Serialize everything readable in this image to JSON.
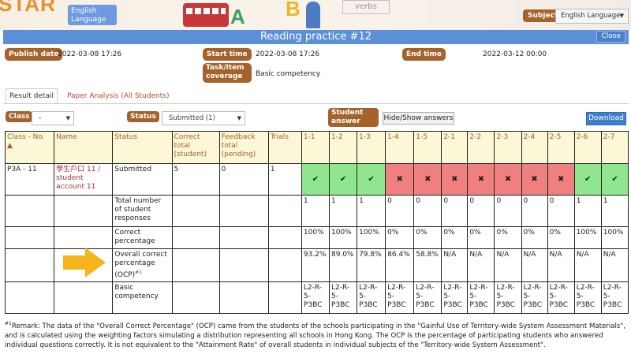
{
  "banner": {
    "logo": "STAR",
    "subject_badge": "English Language",
    "deco_a": "A",
    "deco_b": "B",
    "deco_verbs": "verbs",
    "subject_label": "Subject",
    "subject_value": "English Language"
  },
  "header": {
    "title": "Reading practice #12",
    "close_label": "Close"
  },
  "meta": {
    "publish_label": "Publish date",
    "publish_value": "2022-03-08 17:26",
    "start_label": "Start time",
    "start_value": "2022-03-08 17:26",
    "end_label": "End time",
    "end_value": "2022-03-12 00:00",
    "coverage_label": "Task/item coverage",
    "coverage_value": "Basic competency"
  },
  "tabs": {
    "result": "Result detail",
    "analysis": "Paper Analysis (All Students)"
  },
  "controls": {
    "class_label": "Class",
    "class_value": "-",
    "status_label": "Status",
    "status_value": "Submitted (1)",
    "answer_label": "Student answer",
    "hide_show": "Hide/Show answers",
    "download": "Download"
  },
  "table": {
    "headers": [
      "Class - No. ▲",
      "Name",
      "Status",
      "Correct total (student)",
      "Feedback total (pending)",
      "Trials",
      "1-1",
      "1-2",
      "1-3",
      "1-4",
      "1-5",
      "2-1",
      "2-2",
      "2-3",
      "2-4",
      "2-5",
      "2-6",
      "2-7"
    ],
    "student": {
      "class_no": "P3A - 11",
      "name": "學生戶口 11 / student account 11",
      "status": "Submitted",
      "correct": "5",
      "feedback": "0",
      "trials": "1",
      "marks": [
        "✔",
        "✔",
        "✔",
        "✖",
        "✖",
        "✖",
        "✖",
        "✖",
        "✖",
        "✖",
        "✔",
        "✔"
      ],
      "mark_states": [
        "ok",
        "ok",
        "ok",
        "bad",
        "bad",
        "bad",
        "bad",
        "bad",
        "bad",
        "bad",
        "ok",
        "ok"
      ]
    },
    "rows": [
      {
        "label": "Total number of student responses",
        "values": [
          "1",
          "1",
          "1",
          "0",
          "0",
          "0",
          "0",
          "0",
          "0",
          "0",
          "1",
          "1"
        ]
      },
      {
        "label": "Correct percentage",
        "values": [
          "100%",
          "100%",
          "100%",
          "0%",
          "0%",
          "0%",
          "0%",
          "0%",
          "0%",
          "0%",
          "100%",
          "100%"
        ]
      },
      {
        "label": "Overall correct percentage (OCP)",
        "sup": "#1",
        "values": [
          "93.2%",
          "89.0%",
          "79.8%",
          "86.4%",
          "58.8%",
          "N/A",
          "N/A",
          "N/A",
          "N/A",
          "N/A",
          "N/A",
          "N/A"
        ]
      },
      {
        "label": "Basic competency",
        "values": [
          "L2-R-5-P3BC",
          "L2-R-5-P3BC",
          "L2-R-5-P3BC",
          "L2-R-5-P3BC",
          "L2-R-5-P3BC",
          "L2-R-5-P3BC",
          "L2-R-5-P3BC",
          "L2-R-5-P3BC",
          "L2-R-5-P3BC",
          "L2-R-5-P3BC",
          "L2-R-5-P3BC",
          "L2-R-5-P3BC"
        ]
      }
    ]
  },
  "remark": {
    "sup": "#1",
    "text": "Remark: The data of the \"Overall Correct Percentage\" (OCP) came from the students of the schools participating in the \"Gainful Use of Territory-wide System Assessment Materials\", and is calculated using the weighting factors simulating a distribution representing all schools in Hong Kong. The OCP is the percentage of participating students who answered individual questions correctly. It is not equivalent to the \"Attainment Rate\"   of overall students in individual subjects of the \"Territory-wide System Assessment\"."
  },
  "colors": {
    "accent_brown": "#a5622a",
    "title_blue": "#5b8fd6",
    "correct_green": "#8fe68f",
    "wrong_red": "#f08080",
    "arrow_yellow": "#f7b51d"
  }
}
